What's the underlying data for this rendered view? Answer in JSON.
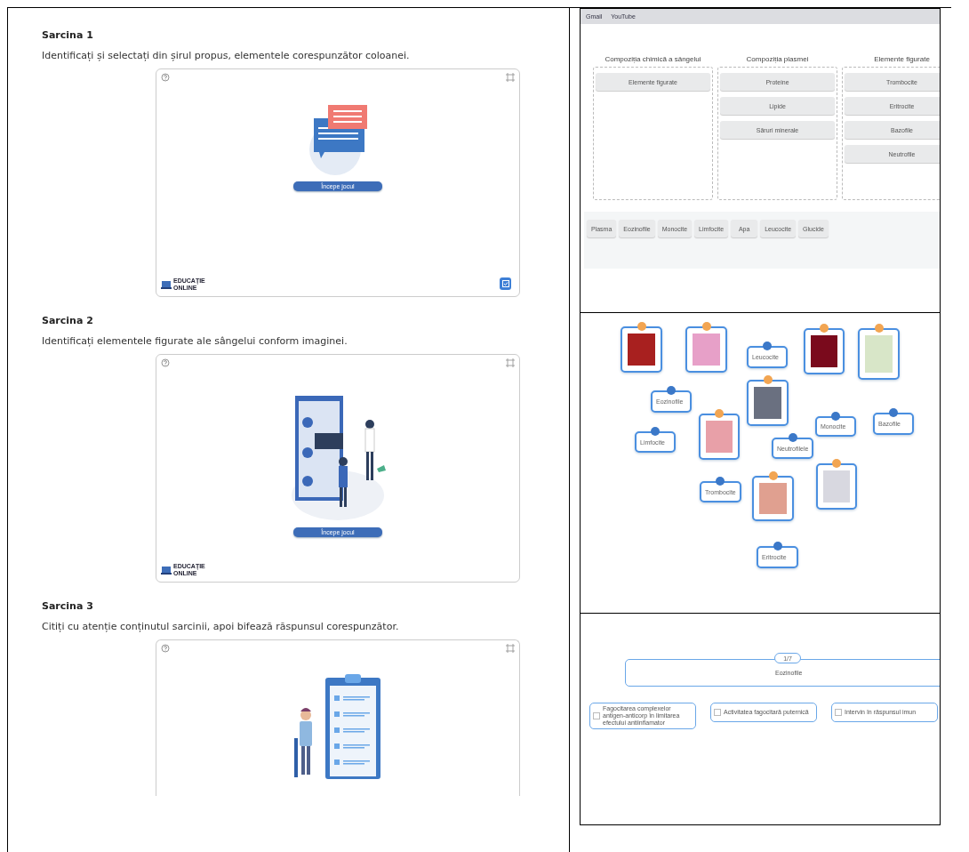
{
  "tasks": [
    {
      "title": "Sarcina 1",
      "instruction": "Identificați și selectați din șirul propus, elementele corespunzător coloanei.",
      "kind": "chat",
      "start_button": "Începe jocul",
      "logo": "EDUCAȚIE ONLINE",
      "check_button": true
    },
    {
      "title": "Sarcina 2",
      "instruction": "Identificați elementele figurate ale sângelui conform imaginei.",
      "kind": "board",
      "start_button": "Începe jocul",
      "logo": "EDUCAȚIE ONLINE",
      "check_button": false
    },
    {
      "title": "Sarcina 3",
      "instruction": "Citiți cu atenție conținutul sarcinii, apoi bifează răspunsul corespunzător.",
      "kind": "clipboard"
    }
  ],
  "sort_game": {
    "bookmarks": [
      "Gmail",
      "YouTube"
    ],
    "columns": [
      {
        "title": "Compoziția chimică a sângelui",
        "items": [
          "Elemente figurate"
        ]
      },
      {
        "title": "Compoziția plasmei",
        "items": [
          "Proteine",
          "Lipide",
          "Săruri minerale"
        ]
      },
      {
        "title": "Elemente figurate",
        "items": [
          "Trombocite",
          "Eritrocite",
          "Bazofile",
          "Neutrofile"
        ]
      }
    ],
    "tray": [
      "Plasma",
      "Eozinofile",
      "Monocite",
      "Limfocite",
      "Apa",
      "Leucocite",
      "Glucide"
    ]
  },
  "label_game": {
    "items": [
      {
        "kind": "photo"
      },
      {
        "kind": "photo"
      },
      {
        "kind": "label",
        "text": "Leucocite"
      },
      {
        "kind": "photo"
      },
      {
        "kind": "photo"
      },
      {
        "kind": "label",
        "text": "Eozinofile"
      },
      {
        "kind": "photo"
      },
      {
        "kind": "label",
        "text": "Limfocite"
      },
      {
        "kind": "photo"
      },
      {
        "kind": "label",
        "text": "Monocite"
      },
      {
        "kind": "label",
        "text": "Bazofile"
      },
      {
        "kind": "label",
        "text": "Neutrofilele"
      },
      {
        "kind": "label",
        "text": "Trombocite"
      },
      {
        "kind": "photo"
      },
      {
        "kind": "photo"
      },
      {
        "kind": "label",
        "text": "Eritrocite"
      }
    ]
  },
  "quiz": {
    "counter": "1/7",
    "question": "Eozinofile",
    "options": [
      {
        "text": "Fagocitarea complexelor antigen-anticorp în limitarea efectului antiinflamator",
        "checked": false
      },
      {
        "text": "Activitatea fagocitară puternică",
        "checked": false
      },
      {
        "text": "Intervin în răspunsul imun",
        "checked": false
      }
    ]
  }
}
